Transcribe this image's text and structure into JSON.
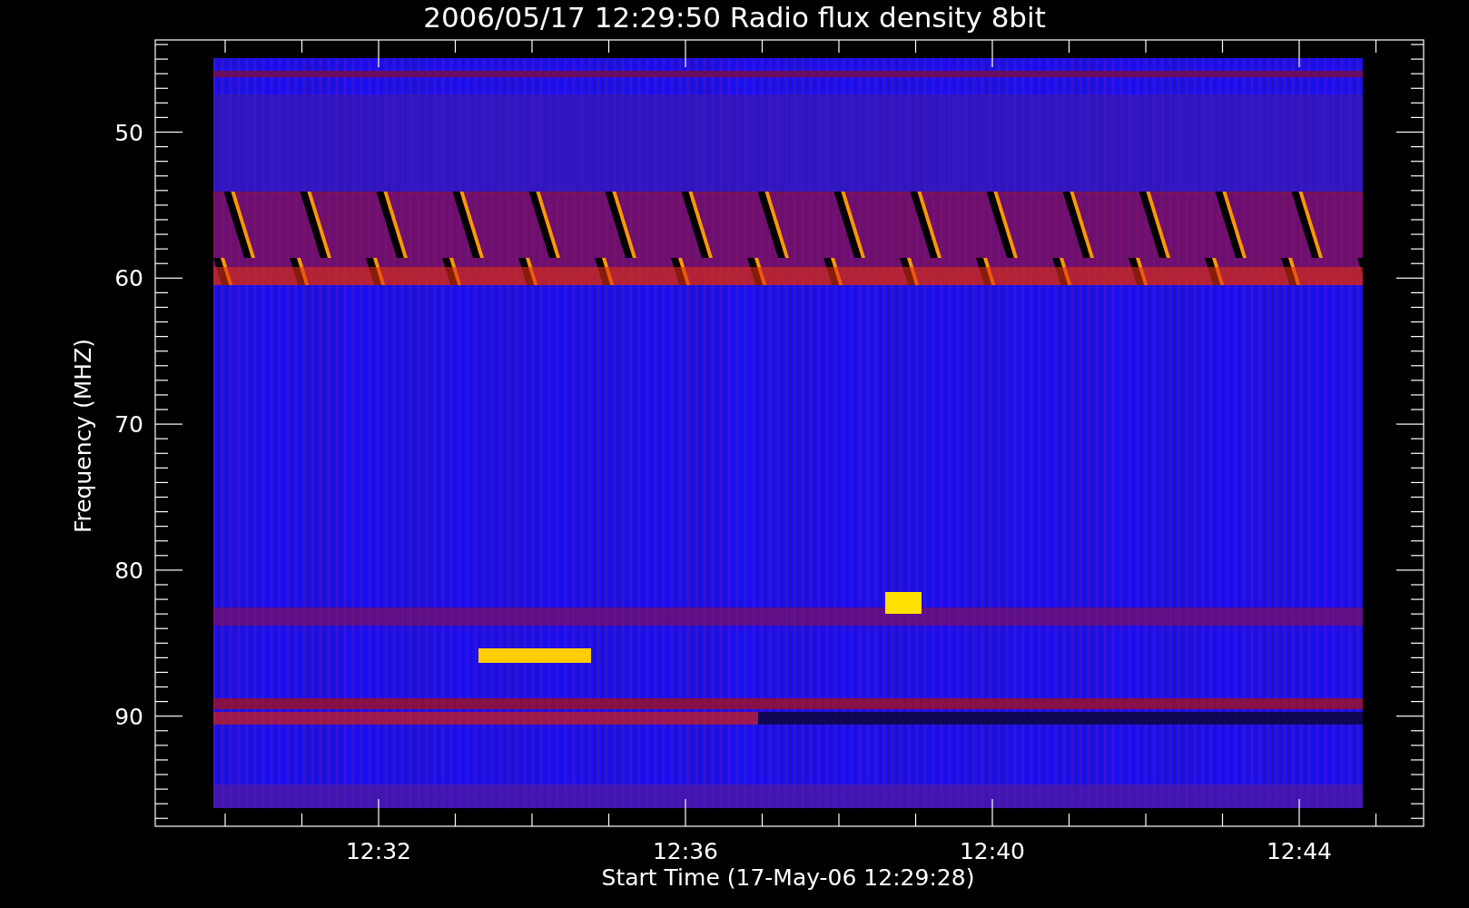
{
  "title": "2006/05/17 12:29:50 Radio flux density 8bit",
  "y_axis": {
    "label": "Frequency (MHZ)",
    "ticks": [
      "50",
      "60",
      "70",
      "80",
      "90"
    ]
  },
  "x_axis": {
    "label": "Start Time (17-May-06 12:29:28)",
    "ticks": [
      "12:32",
      "12:36",
      "12:40",
      "12:44"
    ]
  }
}
